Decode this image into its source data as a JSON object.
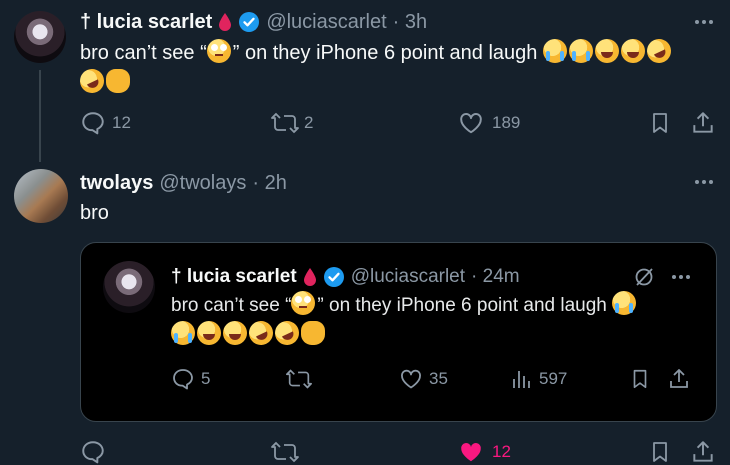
{
  "tweet1": {
    "name": "† lucia scarlet",
    "handle": "@luciascarlet",
    "time": "· 3h",
    "text": "bro can’t see “",
    "text_after": "” on they iPhone 6 point and laugh",
    "replies": "12",
    "retweets": "2",
    "likes": "189"
  },
  "tweet2": {
    "name": "twolays",
    "handle": "@twolays",
    "time": "· 2h",
    "text": "bro",
    "likes": "12"
  },
  "quote": {
    "name": "† lucia scarlet",
    "handle": "@luciascarlet",
    "time": "· 24m",
    "text": "bro can’t see “",
    "text_after": "” on they iPhone 6 point and laugh",
    "replies": "5",
    "likes": "35",
    "views": "597"
  },
  "colors": {
    "background": "#15202b",
    "card_background": "#000000",
    "accent": "#1d9bf0",
    "like_active": "#f91880",
    "muted": "#8b98a5",
    "verified": "#1d9bf0",
    "drop": "#e0245e"
  },
  "icons": [
    "reply-icon",
    "retweet-icon",
    "like-icon",
    "bookmark-icon",
    "share-icon",
    "more-icon",
    "verified-icon",
    "blood-drop-icon",
    "views-icon",
    "grok-icon"
  ]
}
